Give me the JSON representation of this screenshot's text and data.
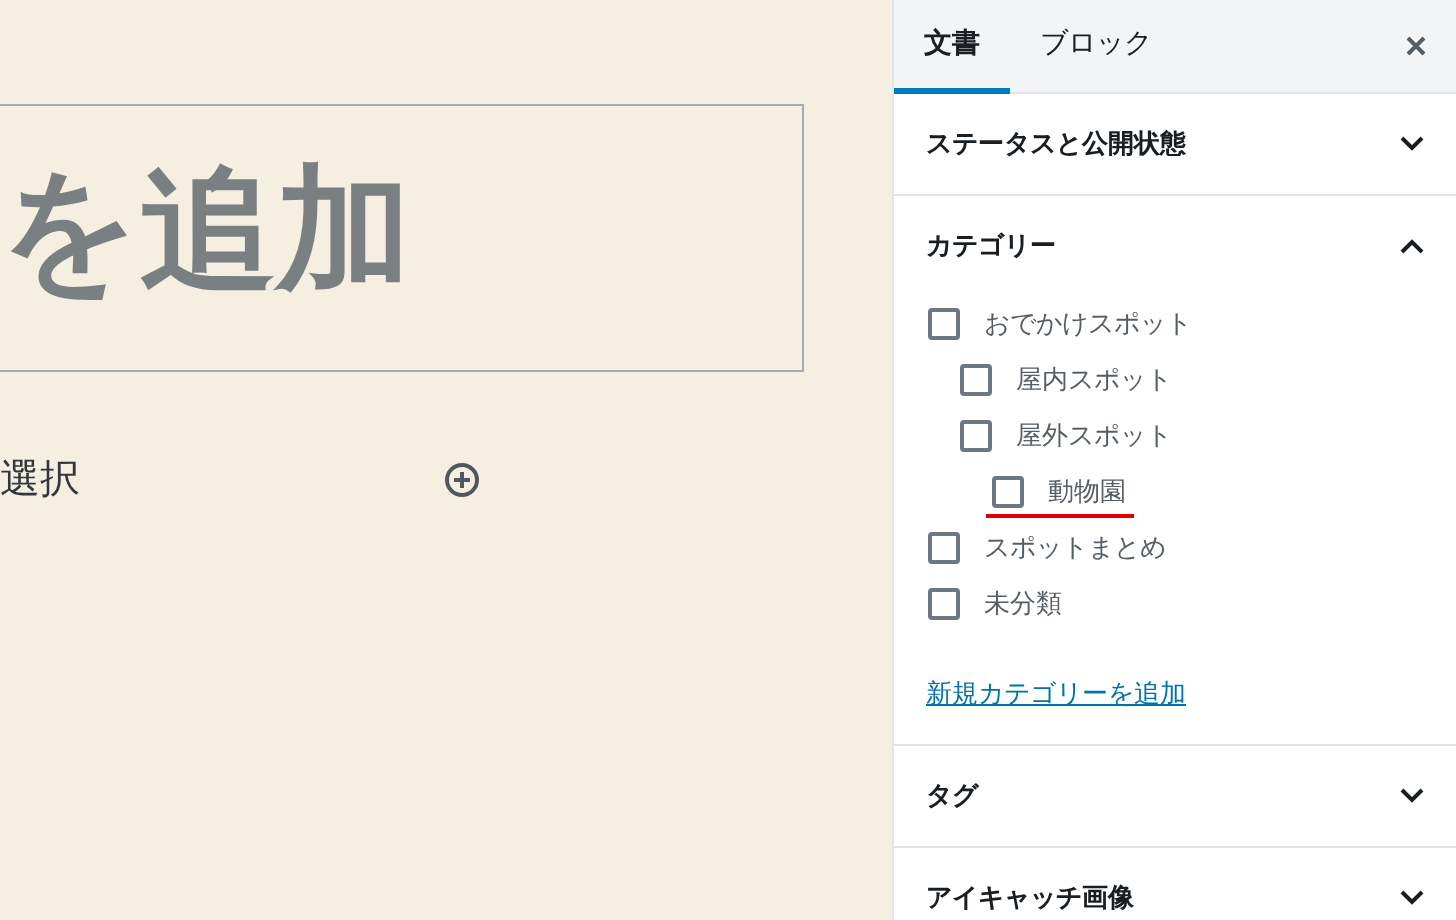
{
  "editor": {
    "title": "を追加",
    "block_prompt": "選択"
  },
  "sidebar": {
    "tabs": [
      {
        "label": "文書",
        "selected": true
      },
      {
        "label": "ブロック",
        "selected": false
      }
    ],
    "panels": [
      {
        "title": "ステータスと公開状態",
        "expanded": false
      },
      {
        "title": "カテゴリー",
        "expanded": true,
        "categories": [
          {
            "label": "おでかけスポット",
            "checked": false,
            "highlighted": false,
            "children": [
              {
                "label": "屋内スポット",
                "checked": false,
                "highlighted": false
              },
              {
                "label": "屋外スポット",
                "checked": false,
                "highlighted": false,
                "children": [
                  {
                    "label": "動物園",
                    "checked": false,
                    "highlighted": true
                  }
                ]
              }
            ]
          },
          {
            "label": "スポットまとめ",
            "checked": false,
            "highlighted": false
          },
          {
            "label": "未分類",
            "checked": false,
            "highlighted": false
          }
        ],
        "add_link": "新規カテゴリーを追加"
      },
      {
        "title": "タグ",
        "expanded": false
      },
      {
        "title": "アイキャッチ画像",
        "expanded": false
      }
    ]
  }
}
